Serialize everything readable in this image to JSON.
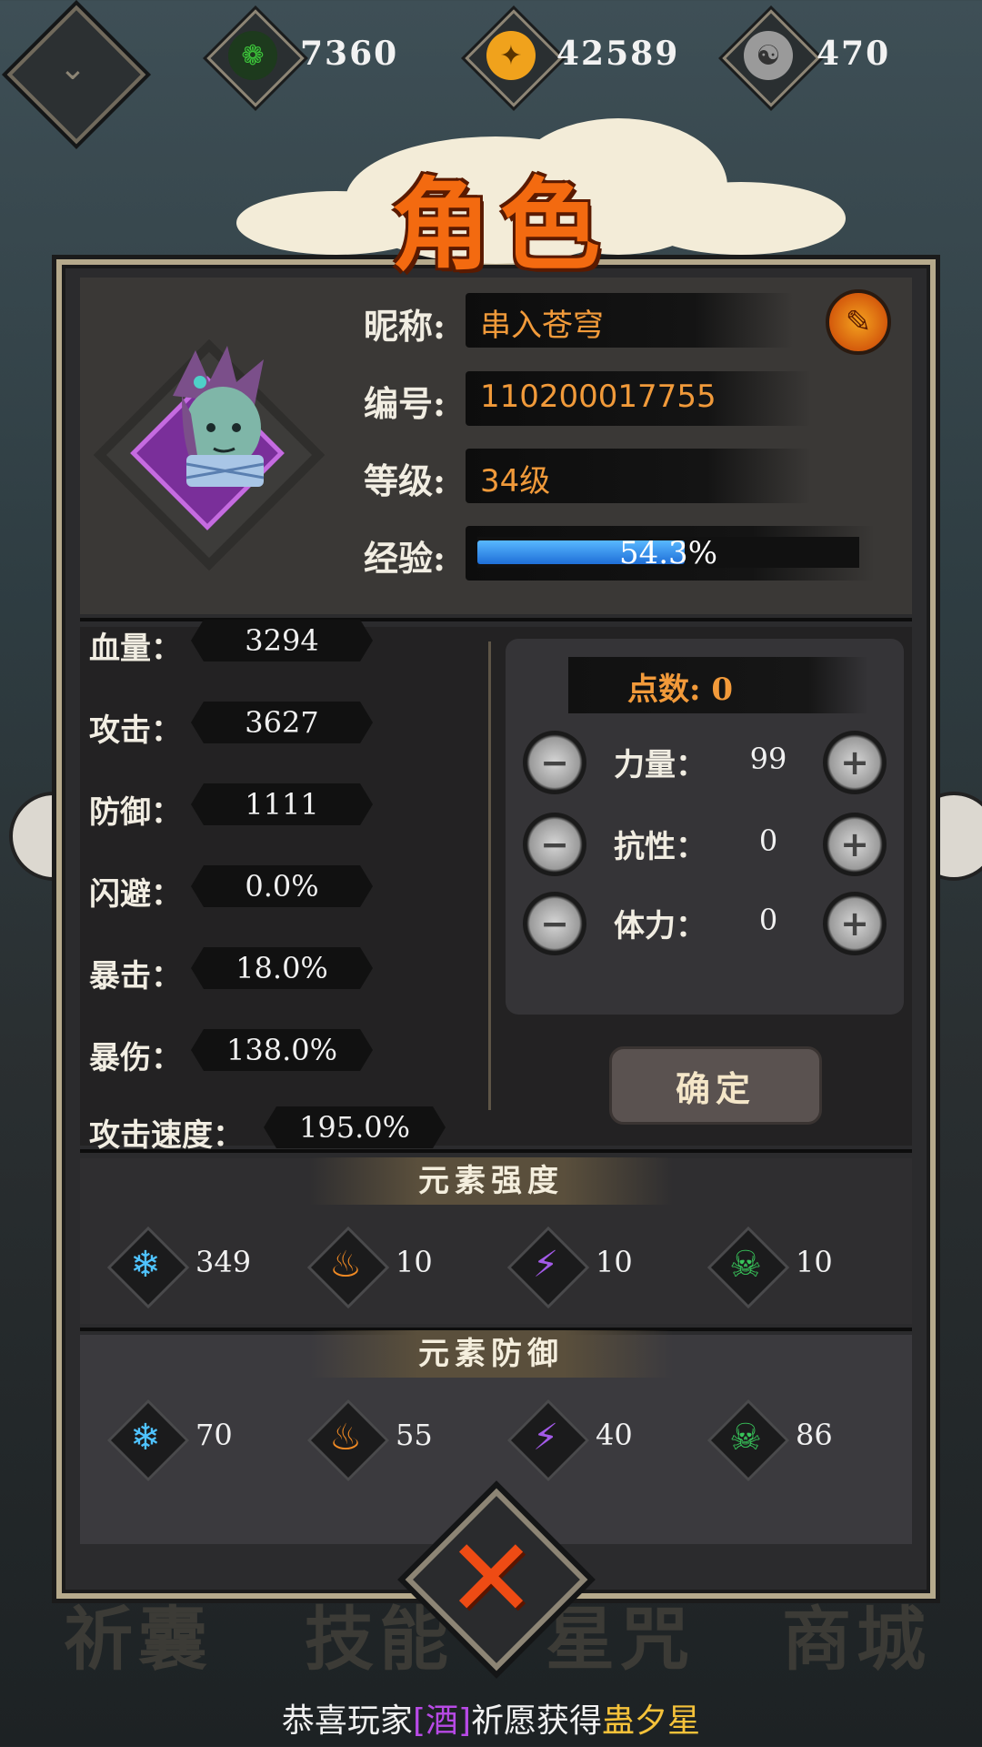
{
  "currencies": [
    {
      "name": "jade",
      "icon": "green-spiral-icon",
      "value": "7360",
      "color": "#3cc43a"
    },
    {
      "name": "gold",
      "icon": "gold-coin-icon",
      "value": "42589",
      "color": "#f0a21c"
    },
    {
      "name": "silver",
      "icon": "silver-swirl-icon",
      "value": "470",
      "color": "#c8c8c8"
    }
  ],
  "title": "角色",
  "profile": {
    "nickname_label": "昵称:",
    "nickname": "串入苍穹",
    "id_label": "编号:",
    "id": "110200017755",
    "level_label": "等级:",
    "level": "34级",
    "exp_label": "经验:",
    "exp_text": "54.3%",
    "exp_fraction": 0.543
  },
  "stats": [
    {
      "label": "血量：",
      "value": "3294"
    },
    {
      "label": "攻击：",
      "value": "3627"
    },
    {
      "label": "防御：",
      "value": "1111"
    },
    {
      "label": "闪避：",
      "value": "0.0%"
    },
    {
      "label": "暴击：",
      "value": "18.0%"
    },
    {
      "label": "暴伤：",
      "value": "138.0%"
    },
    {
      "label": "攻击速度：",
      "value": "195.0%"
    }
  ],
  "points": {
    "label": "点数:",
    "value": "0",
    "attributes": [
      {
        "label": "力量：",
        "value": "99"
      },
      {
        "label": "抗性：",
        "value": "0"
      },
      {
        "label": "体力：",
        "value": "0"
      }
    ],
    "confirm_label": "确定"
  },
  "element_strength": {
    "title": "元素强度",
    "items": [
      {
        "icon": "snowflake-icon",
        "value": "349",
        "color": "#4fc3ff"
      },
      {
        "icon": "fire-icon",
        "value": "10",
        "color": "#f08a24"
      },
      {
        "icon": "lightning-icon",
        "value": "10",
        "color": "#a35ae8"
      },
      {
        "icon": "skull-icon",
        "value": "10",
        "color": "#38c45a"
      }
    ]
  },
  "element_defense": {
    "title": "元素防御",
    "items": [
      {
        "icon": "snowflake-icon",
        "value": "70",
        "color": "#4fc3ff"
      },
      {
        "icon": "fire-icon",
        "value": "55",
        "color": "#f08a24"
      },
      {
        "icon": "lightning-icon",
        "value": "40",
        "color": "#a35ae8"
      },
      {
        "icon": "skull-icon",
        "value": "86",
        "color": "#38c45a"
      }
    ]
  },
  "bottom_tabs": [
    "祈囊",
    "技能",
    "星咒",
    "商城"
  ],
  "ticker": {
    "prefix": "恭喜玩家",
    "tag": "[酒]",
    "middle": "祈愿获得",
    "item": "蛊夕星"
  }
}
